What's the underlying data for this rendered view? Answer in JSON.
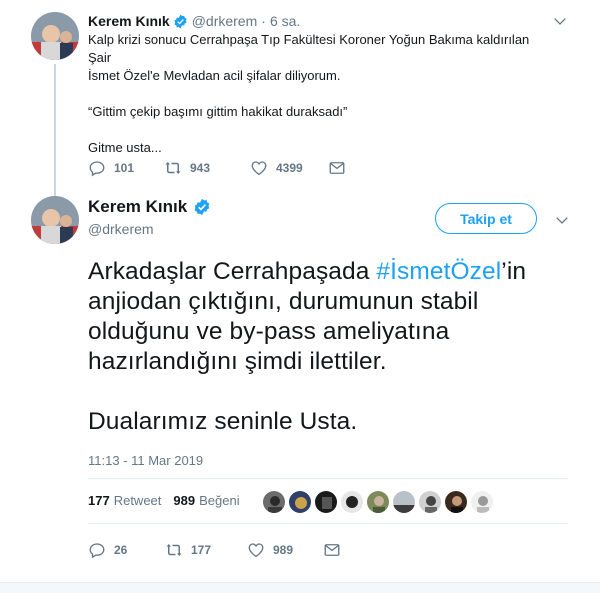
{
  "tweet1": {
    "name": "Kerem Kınık",
    "handle": "@drkerem",
    "separator": "·",
    "time": "6 sa.",
    "text_line1": "Kalp krizi sonucu Cerrahpaşa Tıp Fakültesi Koroner Yoğun Bakıma kaldırılan Şair",
    "text_line2": "İsmet Özel'e Mevladan acil şifalar diliyorum.",
    "quote": "“Gittim çekip başımı gittim hakikat duraksadı”",
    "closing": "Gitme usta...",
    "replies": "101",
    "retweets": "943",
    "likes": "4399"
  },
  "tweet2": {
    "name": "Kerem Kınık",
    "handle": "@drkerem",
    "follow_label": "Takip et",
    "text_prefix": "Arkadaşlar Cerrahpaşada ",
    "hashtag": "#İsmetÖzel",
    "text_rest": "’in anjiodan çıktığını, durumunun stabil olduğunu ve by-pass ameliyatına hazırlandığını şimdi ilettiler.",
    "text_second": "Dualarımız seninle Usta.",
    "timestamp": "11:13 - 11 Mar 2019",
    "retweet_count": "177",
    "retweet_label": "Retweet",
    "like_count": "989",
    "like_label": "Beğeni",
    "replies": "26",
    "retweets": "177",
    "likes": "989"
  },
  "colors": {
    "accent": "#1da1f2",
    "muted": "#657786",
    "text": "#14171a",
    "divider": "#e6ecf0"
  },
  "icons": {
    "verified": "verified-badge-icon",
    "caret": "chevron-down-icon",
    "reply": "reply-icon",
    "retweet": "retweet-icon",
    "like": "heart-icon",
    "dm": "envelope-icon"
  }
}
